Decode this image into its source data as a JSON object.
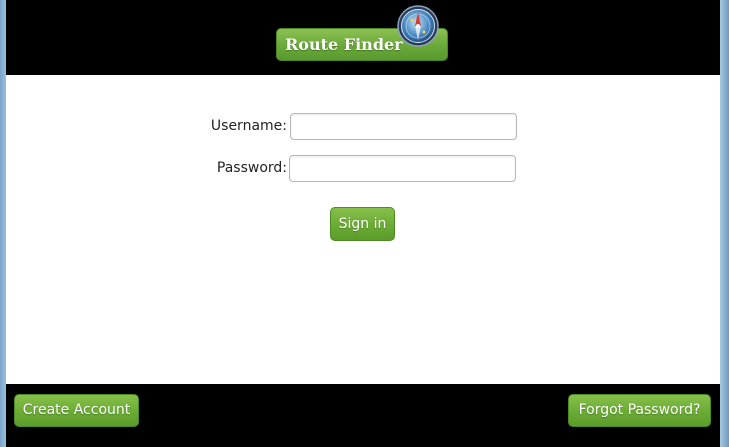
{
  "header": {
    "brand_label": "Route Finder"
  },
  "login_form": {
    "username_label": "Username:",
    "username_value": "",
    "password_label": "Password:",
    "password_value": "",
    "sign_in_label": "Sign in"
  },
  "footer": {
    "create_account_label": "Create Account",
    "forgot_password_label": "Forgot Password?"
  },
  "colors": {
    "accent_green": "#6aab34",
    "header_bg": "#000000",
    "content_bg": "#ffffff"
  },
  "icons": {
    "brand_icon": "compass-icon"
  }
}
